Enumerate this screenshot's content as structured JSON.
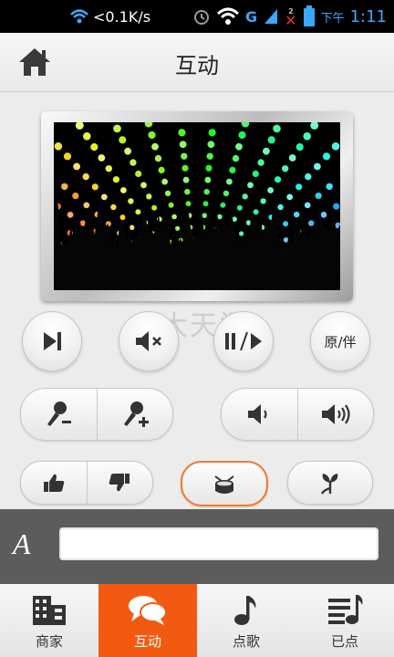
{
  "status_bar": {
    "net_speed": "<0.1K/s",
    "network_type": "G",
    "sim_badge": "2",
    "time_period": "下午",
    "time": "1:11",
    "accent_color": "#3aa8ff"
  },
  "header": {
    "title": "互动",
    "home_icon": "home-icon"
  },
  "video": {
    "scene": "concert-crowd-rainbow-lights"
  },
  "controls": {
    "next_icon": "skip-next-icon",
    "mute_icon": "mute-icon",
    "play_pause_icon": "play-pause-icon",
    "vocal_toggle_label": "原/伴",
    "mic_down_icon": "mic-minus-icon",
    "mic_up_icon": "mic-plus-icon",
    "volume_down_icon": "volume-down-icon",
    "volume_up_icon": "volume-up-icon",
    "thumbs_up_icon": "thumbs-up-icon",
    "thumbs_down_icon": "thumbs-down-icon",
    "drum_icon": "drum-icon",
    "flower_icon": "flower-icon",
    "highlight_color": "#f07a2c"
  },
  "watermark": "大天门",
  "message_bar": {
    "font_button_label": "A",
    "input_value": "",
    "input_placeholder": ""
  },
  "bottom_nav": {
    "active_color": "#f25a12",
    "items": [
      {
        "label": "商家",
        "icon": "building-icon"
      },
      {
        "label": "互动",
        "icon": "chat-bubbles-icon"
      },
      {
        "label": "点歌",
        "icon": "music-note-icon"
      },
      {
        "label": "已点",
        "icon": "playlist-icon"
      }
    ]
  }
}
